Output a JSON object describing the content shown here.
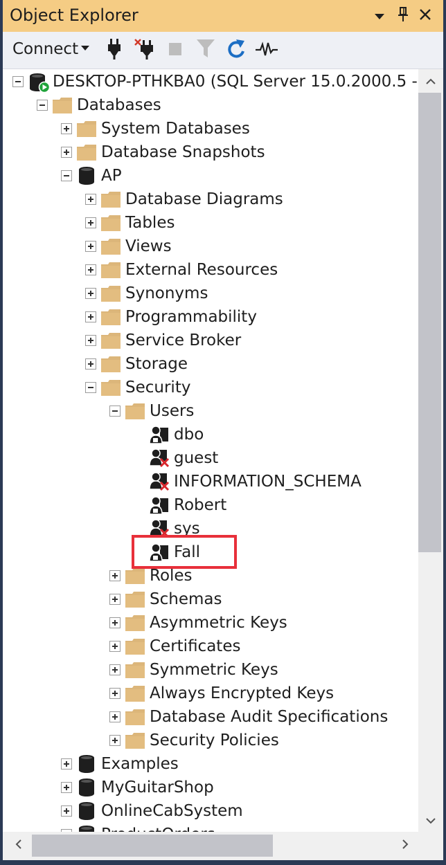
{
  "window": {
    "title": "Object Explorer"
  },
  "toolbar": {
    "connect_label": "Connect"
  },
  "tree": {
    "items": [
      {
        "label": "DESKTOP-PTHKBA0 (SQL Server 15.0.2000.5 - ",
        "icon": "server-icon",
        "expander": "minus",
        "level": 0
      },
      {
        "label": "Databases",
        "icon": "folder-icon",
        "expander": "minus",
        "level": 1
      },
      {
        "label": "System Databases",
        "icon": "folder-icon",
        "expander": "plus",
        "level": 2
      },
      {
        "label": "Database Snapshots",
        "icon": "folder-icon",
        "expander": "plus",
        "level": 2
      },
      {
        "label": "AP",
        "icon": "database-icon",
        "expander": "minus",
        "level": 2
      },
      {
        "label": "Database Diagrams",
        "icon": "folder-icon",
        "expander": "plus",
        "level": 3
      },
      {
        "label": "Tables",
        "icon": "folder-icon",
        "expander": "plus",
        "level": 3
      },
      {
        "label": "Views",
        "icon": "folder-icon",
        "expander": "plus",
        "level": 3
      },
      {
        "label": "External Resources",
        "icon": "folder-icon",
        "expander": "plus",
        "level": 3
      },
      {
        "label": "Synonyms",
        "icon": "folder-icon",
        "expander": "plus",
        "level": 3
      },
      {
        "label": "Programmability",
        "icon": "folder-icon",
        "expander": "plus",
        "level": 3
      },
      {
        "label": "Service Broker",
        "icon": "folder-icon",
        "expander": "plus",
        "level": 3
      },
      {
        "label": "Storage",
        "icon": "folder-icon",
        "expander": "plus",
        "level": 3
      },
      {
        "label": "Security",
        "icon": "folder-icon",
        "expander": "minus",
        "level": 3
      },
      {
        "label": "Users",
        "icon": "folder-icon",
        "expander": "minus",
        "level": 4
      },
      {
        "label": "dbo",
        "icon": "user-icon",
        "expander": "none",
        "level": 5
      },
      {
        "label": "guest",
        "icon": "user-disabled-icon",
        "expander": "none",
        "level": 5
      },
      {
        "label": "INFORMATION_SCHEMA",
        "icon": "user-disabled-icon",
        "expander": "none",
        "level": 5
      },
      {
        "label": "Robert",
        "icon": "user-icon",
        "expander": "none",
        "level": 5
      },
      {
        "label": "sys",
        "icon": "user-disabled-icon",
        "expander": "none",
        "level": 5
      },
      {
        "label": "Fall",
        "icon": "user-icon",
        "expander": "none",
        "level": 5
      },
      {
        "label": "Roles",
        "icon": "folder-icon",
        "expander": "plus",
        "level": 4
      },
      {
        "label": "Schemas",
        "icon": "folder-icon",
        "expander": "plus",
        "level": 4
      },
      {
        "label": "Asymmetric Keys",
        "icon": "folder-icon",
        "expander": "plus",
        "level": 4
      },
      {
        "label": "Certificates",
        "icon": "folder-icon",
        "expander": "plus",
        "level": 4
      },
      {
        "label": "Symmetric Keys",
        "icon": "folder-icon",
        "expander": "plus",
        "level": 4
      },
      {
        "label": "Always Encrypted Keys",
        "icon": "folder-icon",
        "expander": "plus",
        "level": 4
      },
      {
        "label": "Database Audit Specifications",
        "icon": "folder-icon",
        "expander": "plus",
        "level": 4
      },
      {
        "label": "Security Policies",
        "icon": "folder-icon",
        "expander": "plus",
        "level": 4
      },
      {
        "label": "Examples",
        "icon": "database-icon",
        "expander": "plus",
        "level": 2
      },
      {
        "label": "MyGuitarShop",
        "icon": "database-icon",
        "expander": "plus",
        "level": 2
      },
      {
        "label": "OnlineCabSystem",
        "icon": "database-icon",
        "expander": "plus",
        "level": 2
      },
      {
        "label": "ProductOrders",
        "icon": "database-icon",
        "expander": "plus",
        "level": 2
      }
    ]
  },
  "colors": {
    "titlebar": "#f5cc84",
    "toolbar": "#eef0f5",
    "folder": "#dcb67a",
    "highlight": "#e8303a",
    "connected": "#1fa33a",
    "refresh": "#1c6ec4"
  }
}
